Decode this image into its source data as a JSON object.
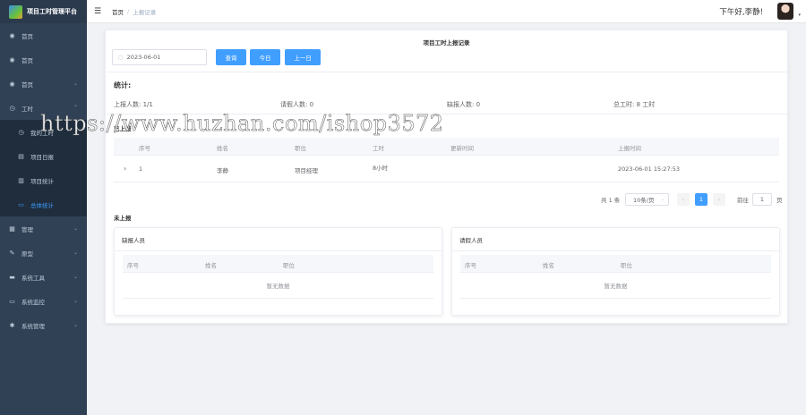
{
  "app": {
    "title": "项目工时管理平台"
  },
  "sidebar": {
    "items": [
      {
        "label": "首页",
        "icon": "dashboard-icon",
        "glyph": "◉"
      },
      {
        "label": "首页",
        "icon": "dashboard-icon",
        "glyph": "◉"
      },
      {
        "label": "首页",
        "icon": "dashboard-icon",
        "glyph": "◉",
        "arrow": "⌄"
      },
      {
        "label": "工时",
        "icon": "clock-icon",
        "glyph": "◷",
        "arrow": "⌃"
      }
    ],
    "submenu": [
      {
        "label": "我的工时",
        "icon": "time-icon",
        "glyph": "◷"
      },
      {
        "label": "项目日报",
        "icon": "doc-icon",
        "glyph": "▤"
      },
      {
        "label": "项目统计",
        "icon": "chart-icon",
        "glyph": "▥"
      },
      {
        "label": "总体统计",
        "icon": "monitor-icon",
        "glyph": "▭"
      }
    ],
    "items2": [
      {
        "label": "管理",
        "icon": "grid-icon",
        "glyph": "▦",
        "arrow": "⌄"
      },
      {
        "label": "原型",
        "icon": "edit-icon",
        "glyph": "✎",
        "arrow": "⌄"
      },
      {
        "label": "系统工具",
        "icon": "tool-icon",
        "glyph": "▬",
        "arrow": "⌄"
      },
      {
        "label": "系统监控",
        "icon": "monitor-icon",
        "glyph": "▭",
        "arrow": "⌄"
      },
      {
        "label": "系统管理",
        "icon": "gear-icon",
        "glyph": "✱",
        "arrow": "⌄"
      }
    ]
  },
  "header": {
    "hamburger": "☰",
    "breadcrumb": {
      "home": "首页",
      "sep": "/",
      "current": "上报记录"
    },
    "greeting": "下午好,李静!",
    "caret": "▾"
  },
  "main": {
    "title": "项目工时上报记录",
    "date_value": "2023-06-01",
    "cal_glyph": "▢",
    "btn_query": "查询",
    "btn_today": "今日",
    "btn_prev": "上一日",
    "stats_title": "统计:",
    "stats": {
      "reported": "上报人数: 1/1",
      "leave": "请假人数: 0",
      "missing": "缺报人数: 0",
      "total_hours": "总工时: 8 工时"
    },
    "reported_title": "已上报",
    "table_headers": [
      "序号",
      "姓名",
      "职位",
      "工时",
      "更新时间",
      "上报时间"
    ],
    "rows": [
      {
        "expand": "›",
        "index": "1",
        "name": "李静",
        "position": "项目经理",
        "hours": "8小时",
        "updated": "",
        "reported": "2023-06-01 15:27:53"
      }
    ],
    "pager": {
      "total": "共 1 条",
      "size": "10条/页",
      "size_caret": "⌄",
      "prev": "‹",
      "page": "1",
      "next": "›",
      "goto": "前往",
      "goto_value": "1",
      "page_unit": "页"
    },
    "unreported_title": "未上报",
    "panels": [
      {
        "title": "缺报人员",
        "headers": [
          "序号",
          "姓名",
          "职位"
        ],
        "empty": "暂无数据"
      },
      {
        "title": "请假人员",
        "headers": [
          "序号",
          "姓名",
          "职位"
        ],
        "empty": "暂无数据"
      }
    ]
  },
  "watermark": "https://www.huzhan.com/ishop3572",
  "colors": {
    "sidebar_bg": "#304156",
    "primary": "#409eff"
  }
}
